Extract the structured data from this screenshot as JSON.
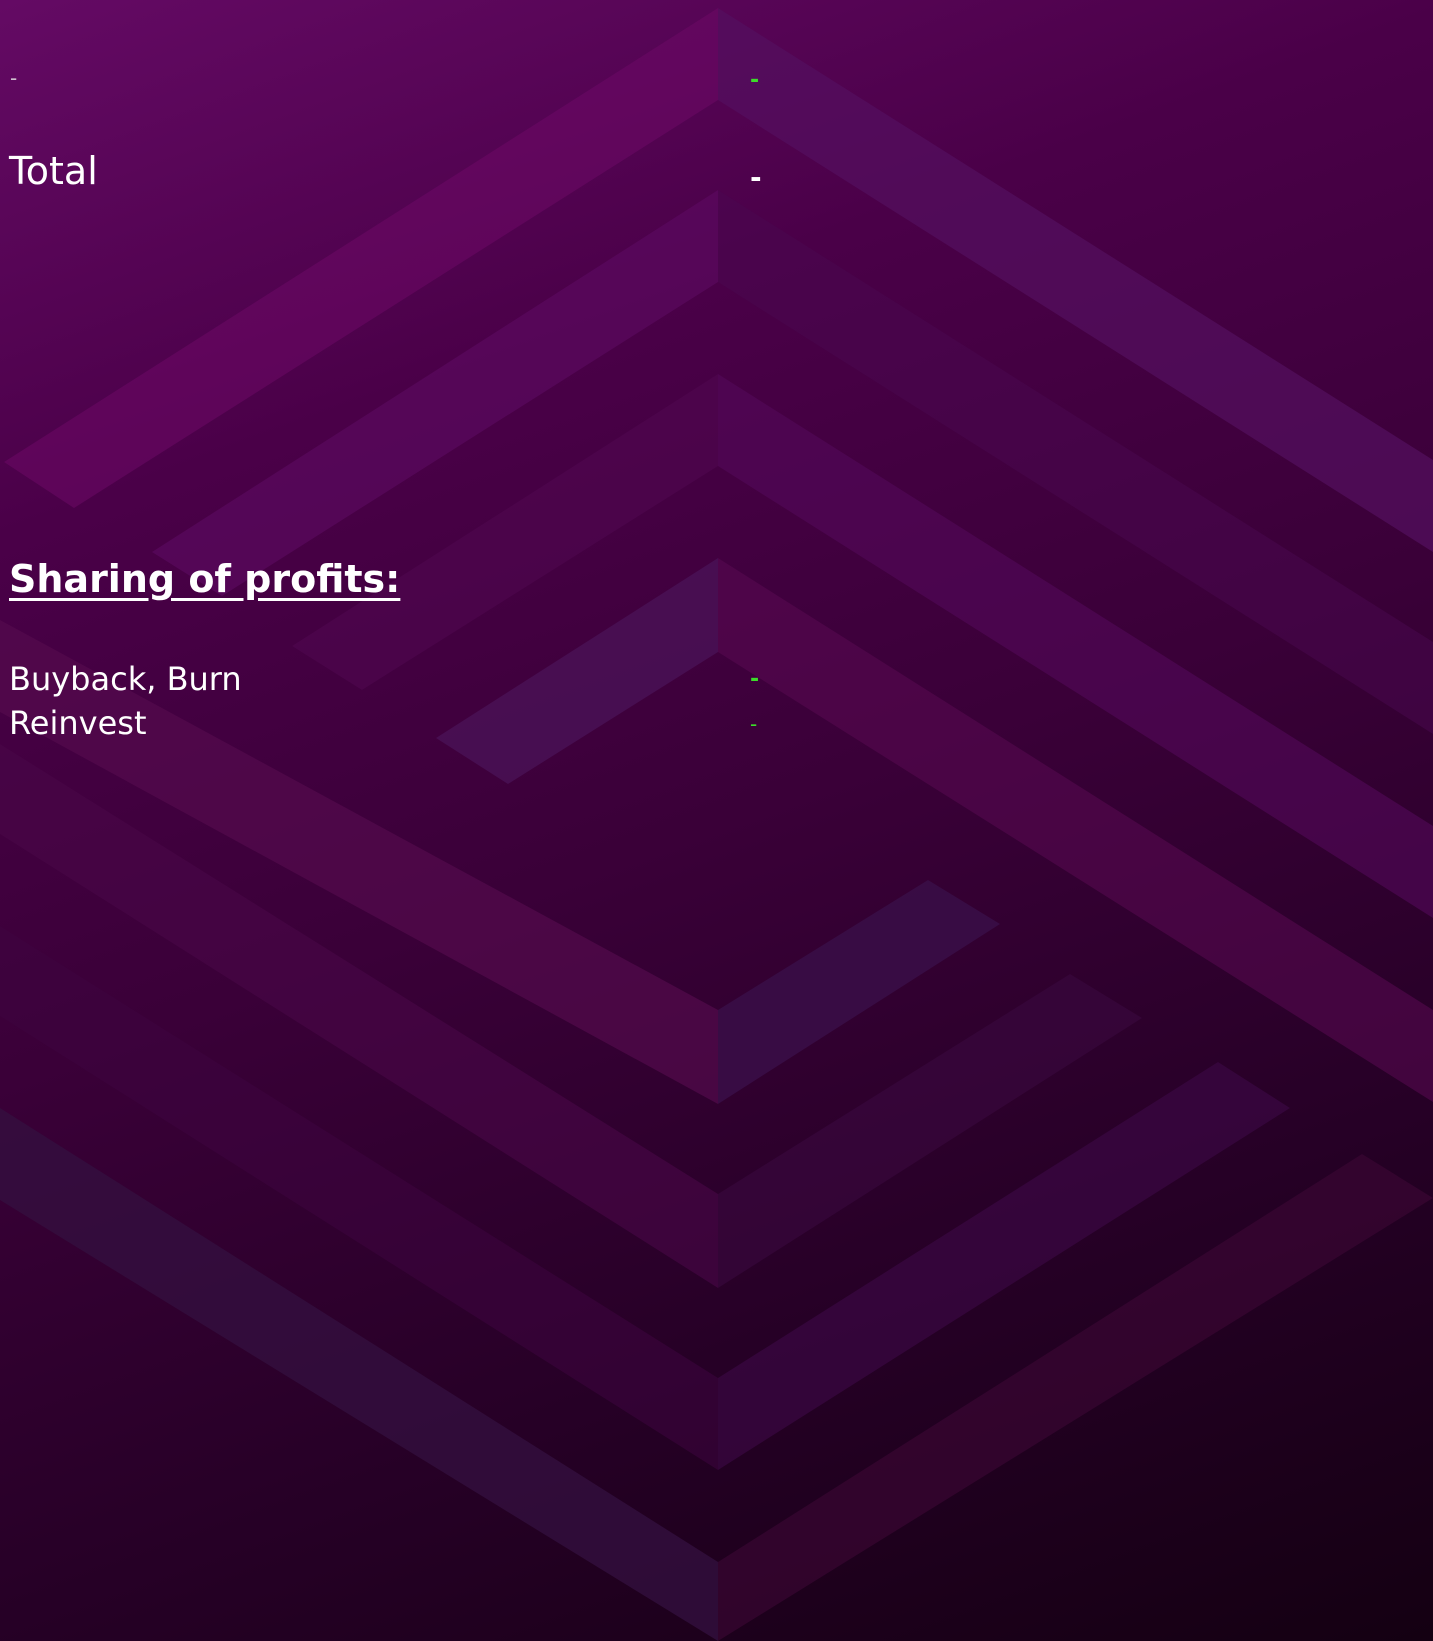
{
  "top_row": {
    "label": "-",
    "value": "-"
  },
  "total": {
    "label": "Total",
    "value": "-"
  },
  "sharing": {
    "title": "Sharing of profits:",
    "rows": [
      {
        "label": "Buyback, Burn",
        "value": "-"
      },
      {
        "label": "Reinvest",
        "value": "-"
      }
    ]
  },
  "colors": {
    "background_top": "#640a64",
    "background_bottom": "#140012",
    "text": "#ffffff",
    "accent_green": "#3ddc2a"
  }
}
